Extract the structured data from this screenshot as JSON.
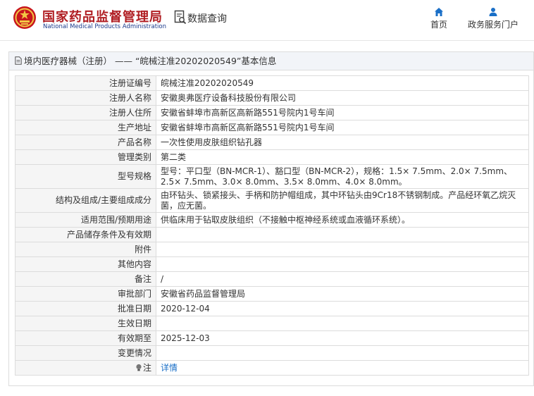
{
  "header": {
    "brand_cn": "国家药品监督管理局",
    "brand_en": "National Medical Products Administration",
    "data_query": "数据查询",
    "nav": {
      "home": "首页",
      "portal": "政务服务门户"
    }
  },
  "panel": {
    "title": "境内医疗器械（注册） —— “皖械注准20202020549”基本信息"
  },
  "rows": [
    {
      "key": "注册证编号",
      "value": "皖械注准20202020549"
    },
    {
      "key": "注册人名称",
      "value": "安徽奥弗医疗设备科技股份有限公司"
    },
    {
      "key": "注册人住所",
      "value": "安徽省蚌埠市高新区高新路551号院内1号车间"
    },
    {
      "key": "生产地址",
      "value": "安徽省蚌埠市高新区高新路551号院内1号车间"
    },
    {
      "key": "产品名称",
      "value": "一次性使用皮肤组织钻孔器"
    },
    {
      "key": "管理类别",
      "value": "第二类"
    },
    {
      "key": "型号规格",
      "value": "型号：平口型（BN-MCR-1）、豁口型（BN-MCR-2），规格：1.5× 7.5mm、2.0× 7.5mm、2.5× 7.5mm、3.0× 8.0mm、3.5× 8.0mm、4.0× 8.0mm。"
    },
    {
      "key": "结构及组成/主要组成成分",
      "value": "由环钻头、锁紧接头、手柄和防护帽组成，其中环钻头由9Cr18不锈钢制成。产品经环氧乙烷灭菌，应无菌。"
    },
    {
      "key": "适用范围/预期用途",
      "value": "供临床用于钻取皮肤组织（不接触中枢神经系统或血液循环系统）。"
    },
    {
      "key": "产品储存条件及有效期",
      "value": ""
    },
    {
      "key": "附件",
      "value": ""
    },
    {
      "key": "其他内容",
      "value": ""
    },
    {
      "key": "备注",
      "value": "/"
    },
    {
      "key": "审批部门",
      "value": "安徽省药品监督管理局"
    },
    {
      "key": "批准日期",
      "value": "2020-12-04"
    },
    {
      "key": "生效日期",
      "value": ""
    },
    {
      "key": "有效期至",
      "value": "2025-12-03"
    },
    {
      "key": "变更情况",
      "value": ""
    },
    {
      "key": "注",
      "value": "详情"
    }
  ],
  "colors": {
    "brand_red": "#b01e23",
    "brand_blue": "#1b3a8c",
    "link": "#1a6fc7",
    "nav_icon": "#1a6fc7"
  },
  "icons": [
    "national-emblem-icon",
    "search-doc-icon",
    "home-icon",
    "user-icon",
    "document-icon",
    "lightbulb-icon"
  ]
}
